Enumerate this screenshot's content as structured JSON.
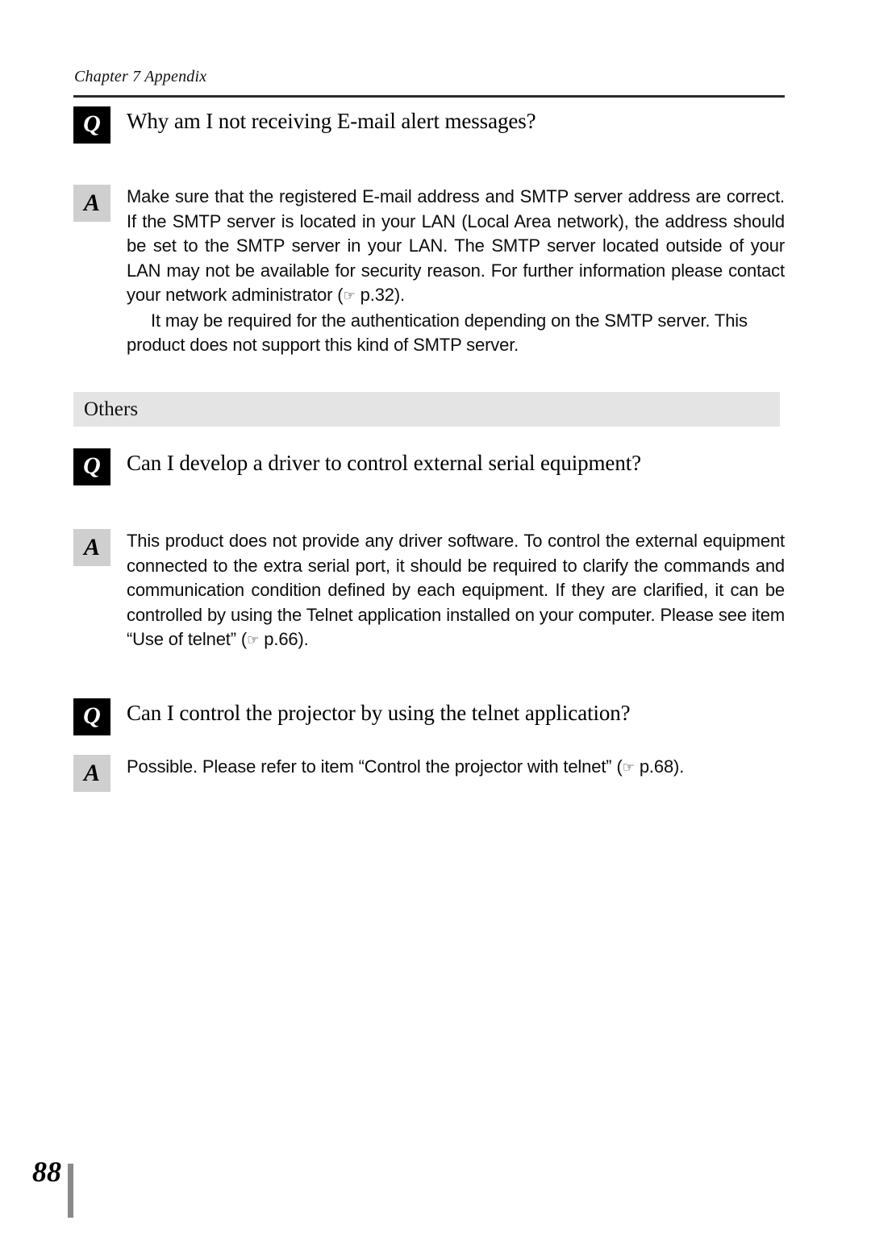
{
  "header": {
    "chapter": "Chapter 7 Appendix"
  },
  "faq": [
    {
      "badge_q": "Q",
      "badge_a": "A",
      "question": "Why am I not receiving E-mail alert messages?",
      "answer_paragraphs": [
        "Make sure that the registered E-mail address and SMTP server address are correct. If the SMTP server is located in your LAN (Local Area network), the address should be set to the SMTP server in your LAN. The SMTP server located outside of your LAN may not be available for security reason. For further information please contact your network administrator (☞ p.32).",
        "It may be required for the authentication depending on the SMTP server. This product does not support this kind of SMTP server."
      ]
    },
    {
      "badge_q": "Q",
      "badge_a": "A",
      "question": "Can I develop a driver to control external serial equipment?",
      "answer_paragraphs": [
        "This product does not provide any driver software. To control the external equipment connected to the extra serial port, it should be required to clarify the commands and communication condition defined by each equipment. If they are clarified, it can be controlled by using the Telnet application installed on your computer. Please see item “Use of telnet” (☞ p.66)."
      ]
    },
    {
      "badge_q": "Q",
      "badge_a": "A",
      "question": "Can I control the projector by using the telnet application?",
      "answer_paragraphs": [
        "Possible. Please refer to item “Control the projector with telnet” (☞ p.68)."
      ]
    }
  ],
  "section": {
    "others_label": "Others"
  },
  "footer": {
    "page_number": "88"
  },
  "colors": {
    "question_badge_bg": "#000000",
    "question_badge_fg": "#ffffff",
    "answer_badge_bg": "#cfcfcf",
    "answer_badge_fg": "#000000",
    "section_band_bg": "#e4e4e4",
    "rule": "#2b2b2b",
    "footer_bar": "#8a8a8a"
  }
}
